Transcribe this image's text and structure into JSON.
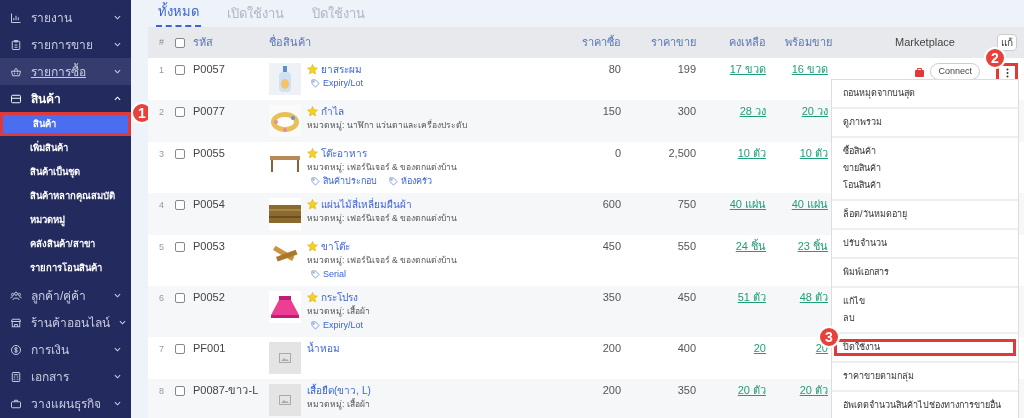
{
  "sidebar": {
    "items": [
      {
        "label": "รายงาน",
        "expanded": false,
        "hovered": false
      },
      {
        "label": "รายการขาย",
        "expanded": false,
        "hovered": false
      },
      {
        "label": "รายการซื้อ",
        "expanded": false,
        "hovered": true
      },
      {
        "label": "สินค้า",
        "expanded": true,
        "hovered": false,
        "children": [
          {
            "label": "สินค้า",
            "selected": true,
            "marker": "1"
          },
          {
            "label": "เพิ่มสินค้า",
            "selected": false
          },
          {
            "label": "สินค้าเป็นชุด",
            "selected": false
          },
          {
            "label": "สินค้าหลากคุณสมบัติ",
            "selected": false
          },
          {
            "label": "หมวดหมู่",
            "selected": false
          },
          {
            "label": "คลังสินค้า/สาขา",
            "selected": false
          },
          {
            "label": "รายการโอนสินค้า",
            "selected": false
          }
        ]
      },
      {
        "label": "ลูกค้า/คู่ค้า",
        "expanded": false,
        "hovered": false
      },
      {
        "label": "ร้านค้าออนไลน์",
        "expanded": false,
        "hovered": false
      },
      {
        "label": "การเงิน",
        "expanded": false,
        "hovered": false
      },
      {
        "label": "เอกสาร",
        "expanded": false,
        "hovered": false
      },
      {
        "label": "วางแผนธุรกิจ",
        "expanded": false,
        "hovered": false
      }
    ]
  },
  "tabs": [
    {
      "label": "ทั้งหมด",
      "selected": true
    },
    {
      "label": "เปิดใช้งาน",
      "selected": false
    },
    {
      "label": "ปิดใช้งาน",
      "selected": false
    }
  ],
  "table": {
    "columns": [
      "#",
      "รหัส",
      "ชื่อสินค้า",
      "ราคาซื้อ",
      "ราคาขาย",
      "คงเหลือ",
      "พร้อมขาย",
      "Marketplace"
    ],
    "header_button": "แก้",
    "select_all_checked": false,
    "rows": [
      {
        "index": "1",
        "checked": false,
        "code": "P0057",
        "has_image": true,
        "starred": true,
        "name": "ยาสระผม",
        "tags": [
          "Expiry/Lot"
        ],
        "buy": "80",
        "sell": "199",
        "remaining": "17 ขวด",
        "ready": "16 ขวด",
        "marketplace": "Connect",
        "menu_open": true,
        "marker": "2"
      },
      {
        "index": "2",
        "checked": false,
        "code": "P0077",
        "has_image": true,
        "starred": true,
        "name": "กำไล",
        "category": "หมวดหมู่: นาฬิกา แว่นตาและเครื่องประดับ",
        "buy": "150",
        "sell": "300",
        "remaining": "28 วง",
        "ready": "20 วง",
        "menu_open": false
      },
      {
        "index": "3",
        "checked": false,
        "code": "P0055",
        "has_image": true,
        "starred": true,
        "name": "โต๊ะอาหาร",
        "category": "หมวดหมู่: เฟอร์นิเจอร์ & ของตกแต่งบ้าน",
        "tags": [
          "สินค้าประกอบ",
          "ห้องครัว"
        ],
        "buy": "0",
        "sell": "2,500",
        "remaining": "10 ตัว",
        "ready": "10 ตัว",
        "menu_open": false
      },
      {
        "index": "4",
        "checked": false,
        "code": "P0054",
        "has_image": true,
        "starred": true,
        "name": "แผ่นไม้สี่เหลี่ยมผืนผ้า",
        "category": "หมวดหมู่: เฟอร์นิเจอร์ & ของตกแต่งบ้าน",
        "buy": "600",
        "sell": "750",
        "remaining": "40 แผ่น",
        "ready": "40 แผ่น",
        "menu_open": false
      },
      {
        "index": "5",
        "checked": false,
        "code": "P0053",
        "has_image": true,
        "starred": true,
        "name": "ขาโต๊ะ",
        "category": "หมวดหมู่: เฟอร์นิเจอร์ & ของตกแต่งบ้าน",
        "tags": [
          "Serial"
        ],
        "buy": "450",
        "sell": "550",
        "remaining": "24 ชิ้น",
        "ready": "23 ชิ้น",
        "menu_open": false
      },
      {
        "index": "6",
        "checked": false,
        "code": "P0052",
        "has_image": true,
        "starred": true,
        "name": "กระโปรง",
        "category": "หมวดหมู่: เสื้อผ้า",
        "tags": [
          "Expiry/Lot"
        ],
        "buy": "350",
        "sell": "450",
        "remaining": "51 ตัว",
        "ready": "48 ตัว",
        "menu_open": false
      },
      {
        "index": "7",
        "checked": false,
        "code": "PF001",
        "has_image": false,
        "starred": false,
        "name": "น้ำหอม",
        "buy": "200",
        "sell": "400",
        "remaining": "20",
        "ready": "20",
        "menu_open": false
      },
      {
        "index": "8",
        "checked": false,
        "code": "P0087-ขาว-L",
        "has_image": false,
        "starred": false,
        "name": "เสื้อยืด(ขาว, L)",
        "category": "หมวดหมู่: เสื้อผ้า",
        "buy": "200",
        "sell": "350",
        "remaining": "20 ตัว",
        "ready": "20 ตัว",
        "menu_open": false
      }
    ]
  },
  "row_menu": {
    "groups": [
      [
        {
          "label": "ถอนหมุดจากบนสุด",
          "highlighted": false
        }
      ],
      [
        {
          "label": "ดูภาพรวม",
          "highlighted": false
        }
      ],
      [
        {
          "label": "ซื้อสินค้า",
          "highlighted": false
        },
        {
          "label": "ขายสินค้า",
          "highlighted": false
        },
        {
          "label": "โอนสินค้า",
          "highlighted": false
        }
      ],
      [
        {
          "label": "ล็อต/วันหมดอายุ",
          "highlighted": false
        }
      ],
      [
        {
          "label": "ปรับจำนวน",
          "highlighted": false
        }
      ],
      [
        {
          "label": "พิมพ์เอกสาร",
          "highlighted": false
        }
      ],
      [
        {
          "label": "แก้ไข",
          "highlighted": false
        },
        {
          "label": "ลบ",
          "highlighted": false
        }
      ],
      [
        {
          "label": "ปิดใช้งาน",
          "highlighted": true,
          "marker": "3"
        }
      ],
      [
        {
          "label": "ราคาขายตามกลุ่ม",
          "highlighted": false
        }
      ],
      [
        {
          "label": "อัพเดตจำนวนสินค้าไปช่องทางการขายอื่น",
          "highlighted": false
        }
      ]
    ]
  }
}
